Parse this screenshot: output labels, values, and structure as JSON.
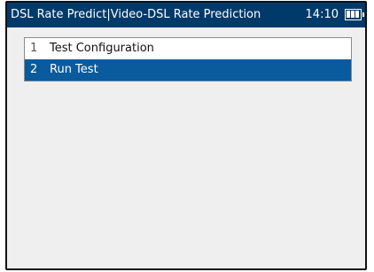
{
  "titlebar": {
    "title": "DSL Rate Predict|Video-DSL Rate Prediction",
    "clock": "14:10",
    "battery_icon": "battery-icon",
    "battery_level": 0.75
  },
  "menu": {
    "items": [
      {
        "number": "1",
        "label": "Test Configuration",
        "selected": false
      },
      {
        "number": "2",
        "label": "Run Test",
        "selected": true
      }
    ]
  },
  "colors": {
    "titlebar_bg": "#003a6b",
    "selected_bg": "#0a5a9e",
    "content_bg": "#efefef"
  }
}
